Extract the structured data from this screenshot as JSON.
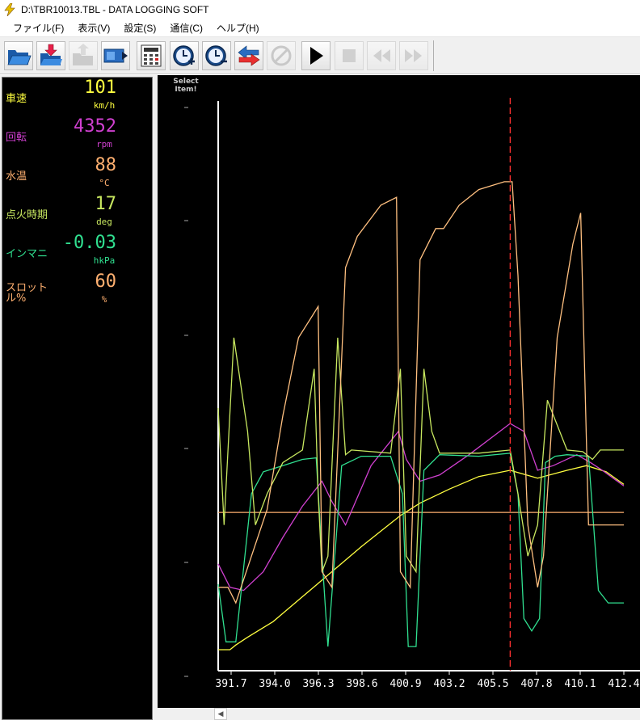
{
  "window": {
    "title": "D:\\TBR10013.TBL - DATA LOGGING SOFT"
  },
  "menu": [
    {
      "label": "ファイル(F)"
    },
    {
      "label": "表示(V)"
    },
    {
      "label": "設定(S)"
    },
    {
      "label": "通信(C)"
    },
    {
      "label": "ヘルプ(H)"
    }
  ],
  "readouts": [
    {
      "label": "車速",
      "value": "101",
      "unit": "km/h",
      "color": "#ffff40"
    },
    {
      "label": "回転",
      "value": "4352",
      "unit": "rpm",
      "color": "#d040d0"
    },
    {
      "label": "水温",
      "value": "88",
      "unit": "°C",
      "color": "#ffb070"
    },
    {
      "label": "点火時期",
      "value": "17",
      "unit": "deg",
      "color": "#c8e860"
    },
    {
      "label": "インマニ",
      "value": "-0.03",
      "unit": "hkPa",
      "color": "#30e090"
    },
    {
      "label": "スロット\nル%",
      "value": "60",
      "unit": "%",
      "color": "#ffb070"
    }
  ],
  "chart": {
    "select_label": "Select\nItem!",
    "colors": {
      "speed": "#ffff40",
      "rpm": "#d040d0",
      "water_temp": "#ffb070",
      "ignition": "#c8e860",
      "manifold": "#30e090",
      "throttle": "#ffc080",
      "cursor": "#ff3030",
      "axis": "#ffffff"
    }
  },
  "chart_data": {
    "type": "line",
    "xlabel": "",
    "ylabel": "",
    "x_ticks": [
      "391.7",
      "394.0",
      "396.3",
      "398.6",
      "400.9",
      "403.2",
      "405.5",
      "407.8",
      "410.1",
      "412.4"
    ],
    "xlim": [
      391.7,
      412.4
    ],
    "cursor_x": 406.6,
    "grid": false,
    "series": [
      {
        "key": "water_temp",
        "x": [
          391.7,
          412.4
        ],
        "y": [
          88,
          88
        ]
      },
      {
        "key": "speed",
        "x": [
          391.7,
          392.3,
          392.6,
          393.2,
          394.5,
          396.0,
          397.5,
          399.0,
          400.0,
          401.0,
          402.0,
          403.5,
          405.0,
          406.6,
          408.0,
          409.5,
          410.5,
          411.5,
          412.4
        ],
        "y": [
          0,
          0,
          3,
          8,
          18,
          34,
          50,
          66,
          76,
          86,
          94,
          103,
          111,
          115,
          110,
          115,
          118,
          114,
          106
        ]
      },
      {
        "key": "rpm",
        "x": [
          391.7,
          392.3,
          393.0,
          394.0,
          395.0,
          396.0,
          397.0,
          397.5,
          398.2,
          399.5,
          400.9,
          401.3,
          402.0,
          403.0,
          404.5,
          406.6,
          407.3,
          408.0,
          408.8,
          410.0,
          410.7,
          411.3,
          412.4
        ],
        "y": [
          55,
          40,
          38,
          50,
          72,
          92,
          108,
          95,
          80,
          118,
          140,
          122,
          108,
          112,
          125,
          145,
          140,
          115,
          118,
          125,
          120,
          115,
          105
        ]
      },
      {
        "key": "manifold",
        "x": [
          391.7,
          392.1,
          392.6,
          393.4,
          394.0,
          395.0,
          396.0,
          396.7,
          397.0,
          397.3,
          398.0,
          399.0,
          400.5,
          401.1,
          401.4,
          401.8,
          402.2,
          403.0,
          405.0,
          406.6,
          407.0,
          407.3,
          407.7,
          408.1,
          408.4,
          408.9,
          409.5,
          410.6,
          411.1,
          411.6,
          412.4
        ],
        "y": [
          42,
          5,
          5,
          100,
          114,
          118,
          122,
          123,
          60,
          2,
          118,
          124,
          124,
          100,
          2,
          2,
          115,
          125,
          124,
          126,
          100,
          20,
          12,
          20,
          120,
          124,
          125,
          124,
          38,
          30,
          30
        ]
      },
      {
        "key": "ignition",
        "x": [
          391.7,
          392.0,
          392.5,
          393.2,
          393.6,
          394.2,
          395.0,
          396.0,
          396.6,
          396.8,
          397.0,
          397.3,
          397.8,
          398.2,
          398.5,
          400.5,
          401.0,
          401.3,
          401.8,
          402.2,
          402.6,
          403.0,
          405.0,
          406.6,
          407.0,
          407.5,
          408.0,
          408.5,
          409.5,
          410.3,
          410.8,
          411.2,
          412.4
        ],
        "y": [
          155,
          80,
          200,
          140,
          80,
          100,
          120,
          128,
          180,
          100,
          50,
          60,
          200,
          125,
          128,
          126,
          180,
          60,
          50,
          180,
          140,
          126,
          126,
          128,
          100,
          60,
          80,
          160,
          128,
          127,
          122,
          128,
          128
        ]
      },
      {
        "key": "throttle",
        "x": [
          391.7,
          392.2,
          392.6,
          393.4,
          394.2,
          395.0,
          395.8,
          396.3,
          396.8,
          397.0,
          397.5,
          398.2,
          398.8,
          400.0,
          400.8,
          401.0,
          401.5,
          402.0,
          402.8,
          403.2,
          404.0,
          405.0,
          406.3,
          406.7,
          407.0,
          407.5,
          408.0,
          408.3,
          409.0,
          409.8,
          410.2,
          410.6,
          412.4
        ],
        "y": [
          40,
          40,
          30,
          60,
          90,
          150,
          200,
          210,
          220,
          50,
          40,
          245,
          265,
          285,
          290,
          50,
          40,
          250,
          270,
          270,
          285,
          295,
          300,
          300,
          240,
          80,
          40,
          60,
          200,
          260,
          280,
          80,
          80
        ]
      }
    ]
  }
}
